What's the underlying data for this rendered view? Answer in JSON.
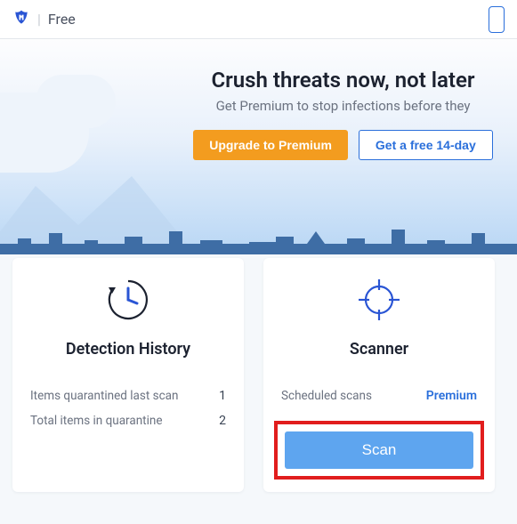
{
  "header": {
    "plan": "Free"
  },
  "hero": {
    "title": "Crush threats now, not later",
    "subtitle": "Get Premium to stop infections before they",
    "upgrade_label": "Upgrade to Premium",
    "trial_label": "Get a free 14-day"
  },
  "cards": {
    "history": {
      "title": "Detection History",
      "quarantined_last_label": "Items quarantined last scan",
      "quarantined_last_value": "1",
      "total_quarantine_label": "Total items in quarantine",
      "total_quarantine_value": "2"
    },
    "scanner": {
      "title": "Scanner",
      "scheduled_label": "Scheduled scans",
      "premium_badge": "Premium",
      "scan_button": "Scan"
    }
  },
  "colors": {
    "accent_orange": "#f39c1f",
    "accent_blue": "#2a6fdb",
    "scan_blue": "#5ea5ef",
    "highlight_red": "#e11d1d"
  }
}
